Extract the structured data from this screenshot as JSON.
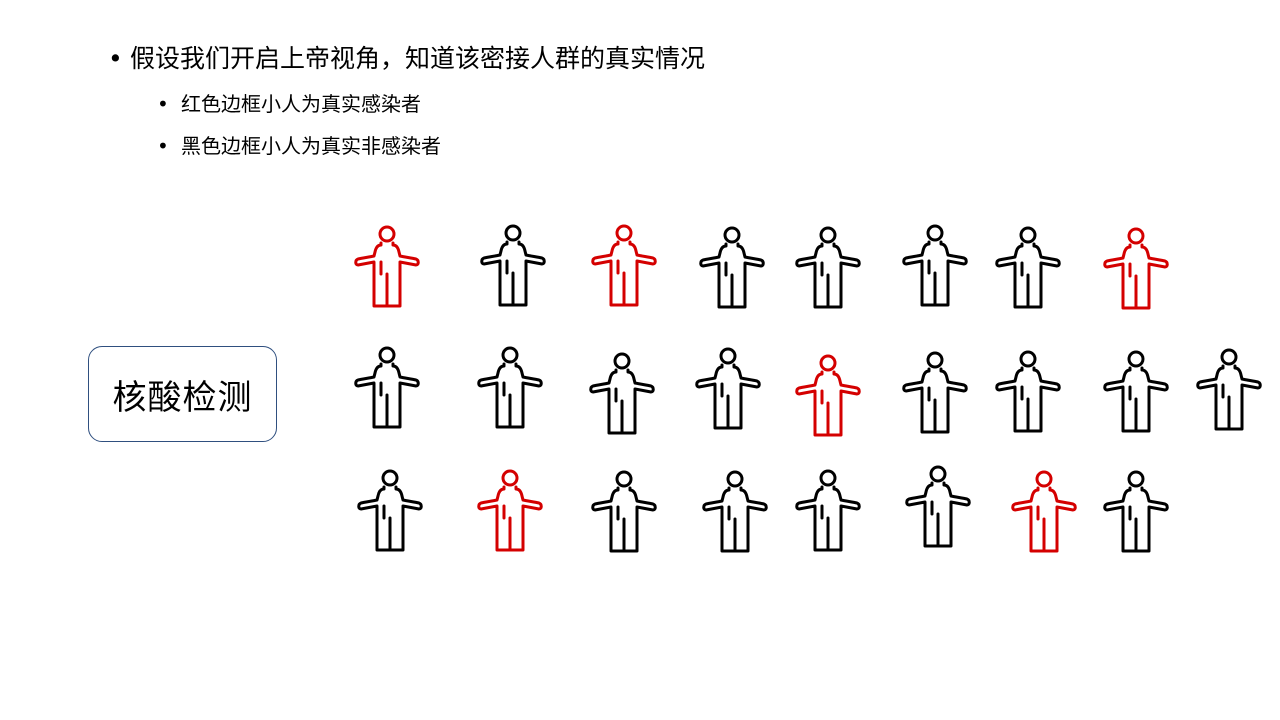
{
  "slide": {
    "bullet_main": "假设我们开启上帝视角，知道该密接人群的真实情况",
    "sub_bullets": [
      "红色边框小人为真实感染者",
      "黑色边框小人为真实非感染者"
    ],
    "test_label": "核酸检测"
  },
  "colors": {
    "infected": "#d40000",
    "non_infected": "#000000",
    "box_border": "#2f4f7f"
  },
  "people": {
    "rows": [
      [
        true,
        false,
        true,
        false,
        false,
        false,
        false,
        true
      ],
      [
        false,
        false,
        false,
        false,
        true,
        false,
        false,
        false,
        false
      ],
      [
        false,
        true,
        false,
        false,
        false,
        false,
        true,
        false
      ]
    ]
  }
}
